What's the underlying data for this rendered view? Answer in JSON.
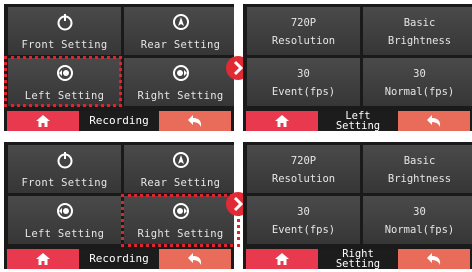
{
  "menu": {
    "front_label": "Front Setting",
    "rear_label": "Rear Setting",
    "left_label": "Left Setting",
    "right_label": "Right Setting",
    "recording_label": "Recording"
  },
  "settings": {
    "resolution_value": "720P",
    "resolution_label": "Resolution",
    "brightness_value": "Basic",
    "brightness_label": "Brightness",
    "event_value": "30",
    "event_label": "Event(fps)",
    "normal_value": "30",
    "normal_label": "Normal(fps)"
  },
  "top_settings_title": [
    "Left",
    "Setting"
  ],
  "bottom_settings_title": [
    "Right",
    "Setting"
  ],
  "colors": {
    "accent_red": "#e22a34",
    "home_button": "#e8394e",
    "back_button": "#e96b5a",
    "tile_bg": "#3f3f3f"
  }
}
